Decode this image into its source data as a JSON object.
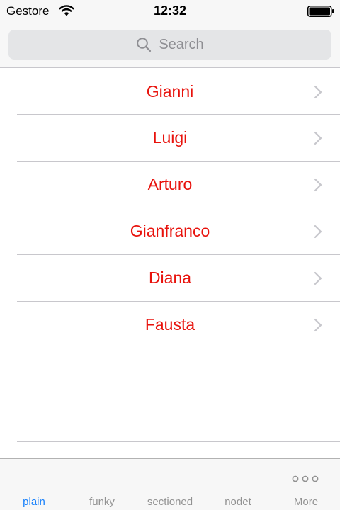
{
  "status_bar": {
    "carrier": "Gestore",
    "time": "12:32"
  },
  "search": {
    "placeholder": "Search"
  },
  "list": {
    "items": [
      {
        "label": "Gianni"
      },
      {
        "label": "Luigi"
      },
      {
        "label": "Arturo"
      },
      {
        "label": "Gianfranco"
      },
      {
        "label": "Diana"
      },
      {
        "label": "Fausta"
      }
    ]
  },
  "tab_bar": {
    "tabs": [
      {
        "label": "plain",
        "selected": true
      },
      {
        "label": "funky",
        "selected": false
      },
      {
        "label": "sectioned",
        "selected": false
      },
      {
        "label": "nodet",
        "selected": false
      },
      {
        "label": "More",
        "selected": false
      }
    ]
  },
  "colors": {
    "item_text": "#e8120c",
    "tab_selected": "#1a82fb",
    "tab_unselected": "#929292"
  }
}
